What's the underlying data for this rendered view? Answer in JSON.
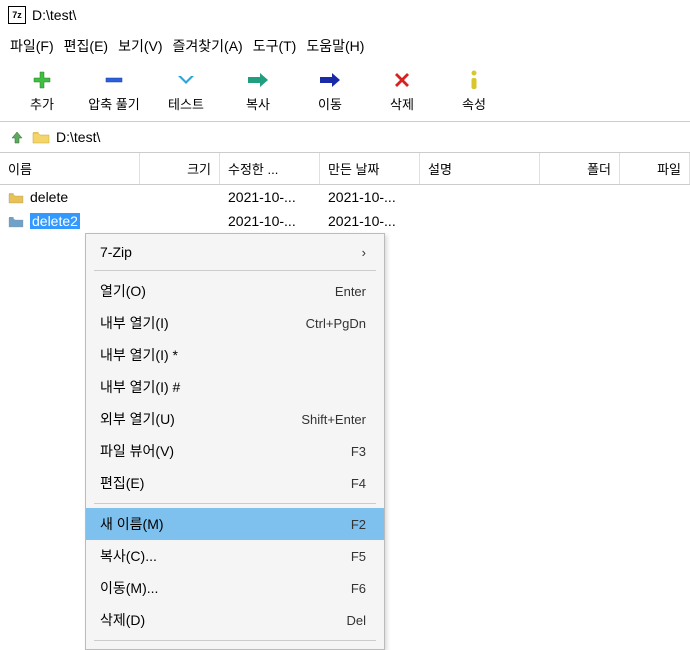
{
  "window": {
    "title": "D:\\test\\"
  },
  "menubar": [
    {
      "label": "파일(F)"
    },
    {
      "label": "편집(E)"
    },
    {
      "label": "보기(V)"
    },
    {
      "label": "즐겨찾기(A)"
    },
    {
      "label": "도구(T)"
    },
    {
      "label": "도움말(H)"
    }
  ],
  "toolbar": [
    {
      "name": "add",
      "label": "추가",
      "icon": "plus",
      "color": "#3fbf3f"
    },
    {
      "name": "extract",
      "label": "압축 풀기",
      "icon": "minus",
      "color": "#2a5fdd"
    },
    {
      "name": "test",
      "label": "테스트",
      "icon": "chevdown",
      "color": "#2aa6d8"
    },
    {
      "name": "copy",
      "label": "복사",
      "icon": "arrow",
      "color": "#1f9f7f"
    },
    {
      "name": "move",
      "label": "이동",
      "icon": "arrow",
      "color": "#1a2ba8"
    },
    {
      "name": "delete",
      "label": "삭제",
      "icon": "x",
      "color": "#d72222"
    },
    {
      "name": "info",
      "label": "속성",
      "icon": "info",
      "color": "#d8c62a"
    }
  ],
  "path": {
    "value": "D:\\test\\"
  },
  "columns": {
    "name": "이름",
    "size": "크기",
    "modified": "수정한 ...",
    "created": "만든 날짜",
    "desc": "설명",
    "folder": "폴더",
    "file": "파일"
  },
  "rows": [
    {
      "name": "delete",
      "modified": "2021-10-...",
      "created": "2021-10-...",
      "selected": false,
      "folderColor": "#e8c254"
    },
    {
      "name": "delete2",
      "modified": "2021-10-...",
      "created": "2021-10-...",
      "selected": true,
      "folderColor": "#6ea2c9"
    }
  ],
  "contextMenu": [
    {
      "type": "item",
      "label": "7-Zip",
      "shortcut": "",
      "submenu": true
    },
    {
      "type": "sep"
    },
    {
      "type": "item",
      "label": "열기(O)",
      "shortcut": "Enter"
    },
    {
      "type": "item",
      "label": "내부 열기(I)",
      "shortcut": "Ctrl+PgDn"
    },
    {
      "type": "item",
      "label": "내부 열기(I) *",
      "shortcut": ""
    },
    {
      "type": "item",
      "label": "내부 열기(I) #",
      "shortcut": ""
    },
    {
      "type": "item",
      "label": "외부 열기(U)",
      "shortcut": "Shift+Enter"
    },
    {
      "type": "item",
      "label": "파일 뷰어(V)",
      "shortcut": "F3"
    },
    {
      "type": "item",
      "label": "편집(E)",
      "shortcut": "F4"
    },
    {
      "type": "sep"
    },
    {
      "type": "item",
      "label": "새 이름(M)",
      "shortcut": "F2",
      "highlight": true
    },
    {
      "type": "item",
      "label": "복사(C)...",
      "shortcut": "F5"
    },
    {
      "type": "item",
      "label": "이동(M)...",
      "shortcut": "F6"
    },
    {
      "type": "item",
      "label": "삭제(D)",
      "shortcut": "Del"
    },
    {
      "type": "sep"
    }
  ]
}
